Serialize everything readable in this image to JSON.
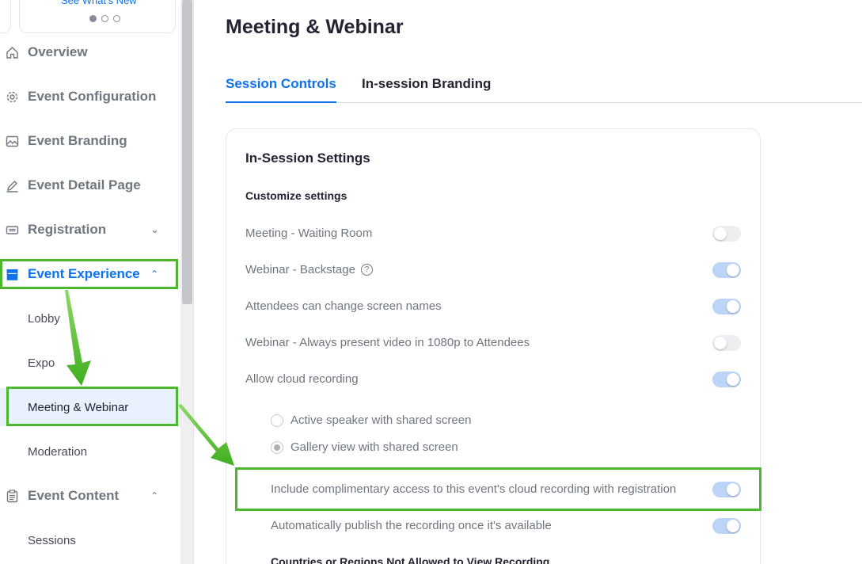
{
  "sidebar": {
    "whats_new": "See What's New",
    "items": [
      {
        "label": "Overview",
        "icon": "home-icon"
      },
      {
        "label": "Event Configuration",
        "icon": "gear-icon"
      },
      {
        "label": "Event Branding",
        "icon": "image-icon"
      },
      {
        "label": "Event Detail Page",
        "icon": "pencil-icon"
      },
      {
        "label": "Registration",
        "icon": "ticket-icon"
      },
      {
        "label": "Event Experience",
        "icon": "store-icon"
      },
      {
        "label": "Event Content",
        "icon": "clipboard-icon"
      }
    ],
    "sub_items": [
      "Lobby",
      "Expo",
      "Meeting & Webinar",
      "Moderation",
      "Sessions"
    ]
  },
  "main": {
    "title": "Meeting & Webinar",
    "tabs": [
      {
        "label": "Session Controls"
      },
      {
        "label": "In-session Branding"
      }
    ],
    "card": {
      "title": "In-Session Settings",
      "subtitle": "Customize settings",
      "settings": [
        {
          "label": "Meeting - Waiting Room",
          "on": false
        },
        {
          "label": "Webinar - Backstage",
          "on": true
        },
        {
          "label": "Attendees can change screen names",
          "on": true
        },
        {
          "label": "Webinar - Always present video in 1080p to Attendees",
          "on": false
        },
        {
          "label": "Allow cloud recording",
          "on": true
        }
      ],
      "radios": [
        {
          "label": "Active speaker with shared screen",
          "checked": false
        },
        {
          "label": "Gallery view with shared screen",
          "checked": true
        }
      ],
      "recording_settings": [
        {
          "label": "Include complimentary access to this event's cloud recording with registration",
          "on": true
        },
        {
          "label": "Automatically publish the recording once it's available",
          "on": true
        }
      ],
      "countries_heading": "Countries or Regions Not Allowed to View Recording"
    }
  },
  "colors": {
    "accent": "#0e72ed",
    "highlight": "#4db82e",
    "toggle_on": "#bcd4f6"
  }
}
